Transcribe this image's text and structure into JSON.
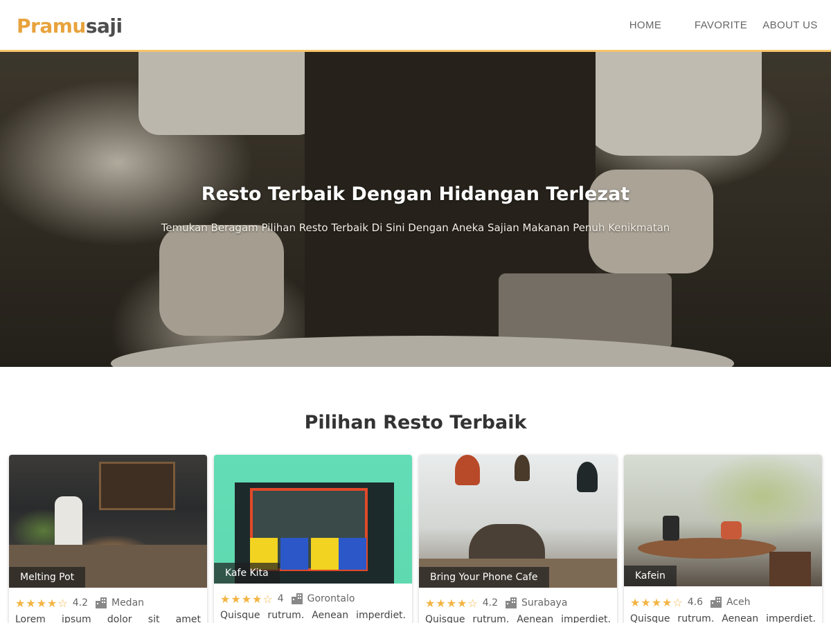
{
  "header": {
    "brand_part1": "Pramu",
    "brand_part2": "saji",
    "nav": [
      {
        "label": "HOME"
      },
      {
        "label": "FAVORITE"
      },
      {
        "label": "ABOUT US"
      }
    ]
  },
  "hero": {
    "title": "Resto Terbaik Dengan Hidangan Terlezat",
    "subtitle": "Temukan Beragam Pilihan Resto Terbaik Di Sini Dengan Aneka Sajian Makanan Penuh Kenikmatan"
  },
  "section": {
    "title": "Pilihan Resto Terbaik"
  },
  "restaurants": [
    {
      "name": "Melting Pot",
      "stars": "★★★★☆",
      "rating": "4.2",
      "city": "Medan",
      "description": "Lorem ipsum dolor sit amet"
    },
    {
      "name": "Kafe Kita",
      "stars": "★★★★☆",
      "rating": "4",
      "city": "Gorontalo",
      "description": "Quisque rutrum. Aenean imperdiet."
    },
    {
      "name": "Bring Your Phone Cafe",
      "stars": "★★★★☆",
      "rating": "4.2",
      "city": "Surabaya",
      "description": "Quisque rutrum. Aenean imperdiet."
    },
    {
      "name": "Kafein",
      "stars": "★★★★☆",
      "rating": "4.6",
      "city": "Aceh",
      "description": "Quisque rutrum. Aenean imperdiet."
    }
  ],
  "colors": {
    "brand_orange": "#e8a33d",
    "brand_dark": "#4d4d4d",
    "nav_border": "#f6c46a",
    "star": "#f3b443"
  },
  "icons": {
    "city": "city-building-icon",
    "star": "star-icon"
  }
}
